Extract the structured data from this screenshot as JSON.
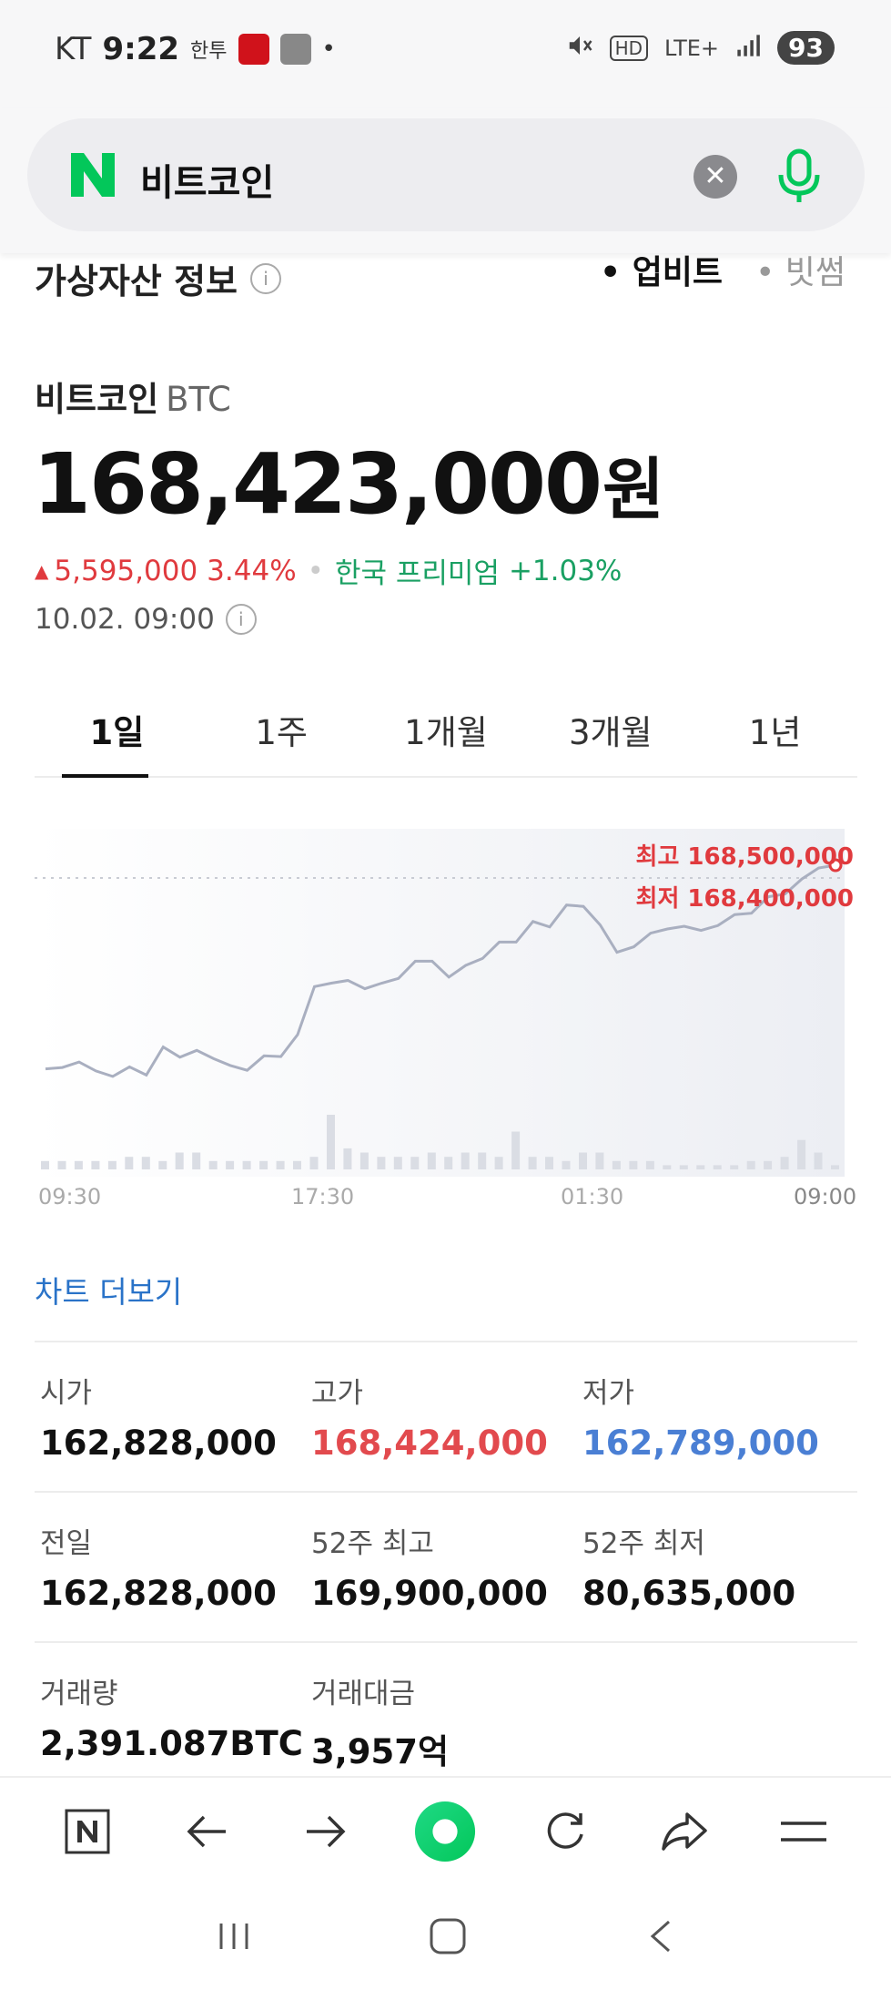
{
  "status_bar": {
    "carrier": "KT",
    "time": "9:22",
    "extra_text": "한투",
    "battery": "93",
    "network": "LTE+",
    "hd": "HD"
  },
  "search": {
    "query": "비트코인"
  },
  "section": {
    "title": "가상자산 정보",
    "exchanges": [
      "업비트",
      "빗썸"
    ],
    "active_exchange": "업비트"
  },
  "coin": {
    "name": "비트코인",
    "symbol": "BTC",
    "price": "168,423,000",
    "unit": "원",
    "change_amount": "5,595,000",
    "change_percent": "3.44%",
    "premium_label": "한국 프리미엄",
    "premium_value": "+1.03%",
    "timestamp": "10.02. 09:00"
  },
  "period_tabs": [
    "1일",
    "1주",
    "1개월",
    "3개월",
    "1년"
  ],
  "chart_data": {
    "type": "line",
    "x_tick_labels": [
      "09:30",
      "17:30",
      "01:30",
      "09:00"
    ],
    "high_label": "최고 168,500,000",
    "low_label": "최저 168,400,000",
    "colors": {
      "line": "#a9afc0",
      "high_low": "#e03a3e"
    },
    "series": [
      {
        "values": [
          163.35,
          163.37,
          163.45,
          163.32,
          163.24,
          163.38,
          163.26,
          163.67,
          163.52,
          163.62,
          163.5,
          163.4,
          163.33,
          163.54,
          163.53,
          163.85,
          164.55,
          164.6,
          164.64,
          164.52,
          164.6,
          164.67,
          164.92,
          164.92,
          164.69,
          164.86,
          164.96,
          165.2,
          165.2,
          165.5,
          165.42,
          165.74,
          165.72,
          165.45,
          165.05,
          165.13,
          165.33,
          165.39,
          165.43,
          165.37,
          165.44,
          165.6,
          165.62,
          165.86,
          165.9,
          166.12,
          166.28,
          166.32
        ]
      }
    ],
    "volume": [
      2,
      2,
      2,
      2,
      2,
      3,
      3,
      2,
      4,
      4,
      2,
      2,
      2,
      2,
      2,
      2,
      3,
      13,
      5,
      4,
      3,
      3,
      3,
      4,
      3,
      4,
      4,
      3,
      9,
      3,
      3,
      2,
      4,
      4,
      2,
      2,
      2,
      1,
      1,
      1,
      1,
      1,
      2,
      2,
      3,
      7,
      4,
      1
    ]
  },
  "chart_more": "차트 더보기",
  "stats": [
    [
      {
        "label": "시가",
        "value": "162,828,000",
        "tone": ""
      },
      {
        "label": "고가",
        "value": "168,424,000",
        "tone": "high"
      },
      {
        "label": "저가",
        "value": "162,789,000",
        "tone": "low"
      }
    ],
    [
      {
        "label": "전일",
        "value": "162,828,000",
        "tone": ""
      },
      {
        "label": "52주 최고",
        "value": "169,900,000",
        "tone": ""
      },
      {
        "label": "52주 최저",
        "value": "80,635,000",
        "tone": ""
      }
    ],
    [
      {
        "label": "거래량",
        "value": "2,391.087BTC",
        "tone": ""
      },
      {
        "label": "거래대금",
        "value": "3,957억",
        "tone": ""
      }
    ]
  ],
  "toolbar_icons": [
    "naver-home-icon",
    "back-arrow-icon",
    "forward-arrow-icon",
    "green-dot-icon",
    "refresh-icon",
    "share-icon",
    "menu-icon"
  ],
  "nav_icons": [
    "recent-apps-icon",
    "home-icon",
    "back-icon"
  ]
}
